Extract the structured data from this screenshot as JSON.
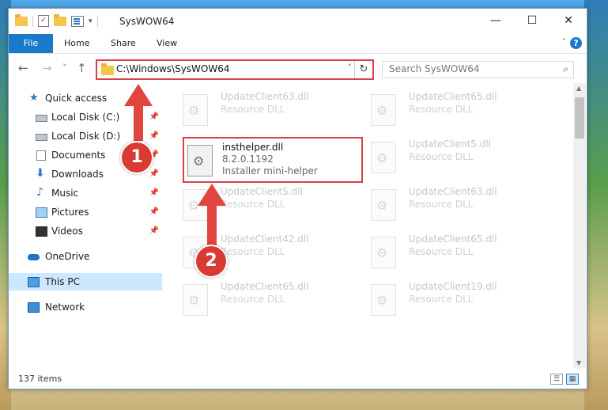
{
  "window": {
    "title": "SysWOW64",
    "controls": {
      "minimize": "—",
      "maximize": "☐",
      "close": "✕"
    }
  },
  "ribbon": {
    "file_tab": "File",
    "tabs": [
      "Home",
      "Share",
      "View"
    ],
    "help": "?"
  },
  "nav": {
    "back": "←",
    "forward": "→",
    "recent": "˅",
    "up": "↑",
    "address": "C:\\Windows\\SysWOW64",
    "address_dropdown": "˅",
    "refresh": "↻",
    "search_placeholder": "Search SysWOW64",
    "search_icon": "⌕"
  },
  "sidebar": {
    "items": [
      {
        "label": "Quick access",
        "icon": "star-icon"
      },
      {
        "label": "Local Disk (C:)",
        "icon": "disk-icon",
        "pinned": true
      },
      {
        "label": "Local Disk (D:)",
        "icon": "disk-icon",
        "pinned": true
      },
      {
        "label": "Documents",
        "icon": "document-icon",
        "pinned": true
      },
      {
        "label": "Downloads",
        "icon": "download-icon",
        "pinned": true
      },
      {
        "label": "Music",
        "icon": "music-icon",
        "pinned": true
      },
      {
        "label": "Pictures",
        "icon": "picture-icon",
        "pinned": true
      },
      {
        "label": "Videos",
        "icon": "video-icon",
        "pinned": true
      },
      {
        "label": "OneDrive",
        "icon": "cloud-icon"
      },
      {
        "label": "This PC",
        "icon": "computer-icon",
        "selected": true
      },
      {
        "label": "Network",
        "icon": "network-icon"
      }
    ],
    "pin_glyph": "📌"
  },
  "files": {
    "left": [
      {
        "name": "UpdateClient63.dll",
        "desc": "Resource DLL"
      },
      {
        "name": "insthelper.dll",
        "version": "8.2.0.1192",
        "desc": "Installer mini-helper",
        "highlighted": true
      },
      {
        "name": "UpdateClient5.dll",
        "desc": "Resource DLL"
      },
      {
        "name": "UpdateClient42.dll",
        "desc": "Resource DLL"
      },
      {
        "name": "UpdateClient65.dll",
        "desc": "Resource DLL"
      }
    ],
    "right": [
      {
        "name": "UpdateClient65.dll",
        "desc": "Resource DLL"
      },
      {
        "name": "UpdateClient5.dll",
        "desc": "Resource DLL"
      },
      {
        "name": "UpdateClient63.dll",
        "desc": "Resource DLL"
      },
      {
        "name": "UpdateClient65.dll",
        "desc": "Resource DLL"
      },
      {
        "name": "UpdateClient19.dll",
        "desc": "Resource DLL"
      }
    ]
  },
  "status": {
    "item_count": "137 items"
  },
  "annotations": {
    "step1": "1",
    "step2": "2",
    "color": "#d83b34"
  }
}
